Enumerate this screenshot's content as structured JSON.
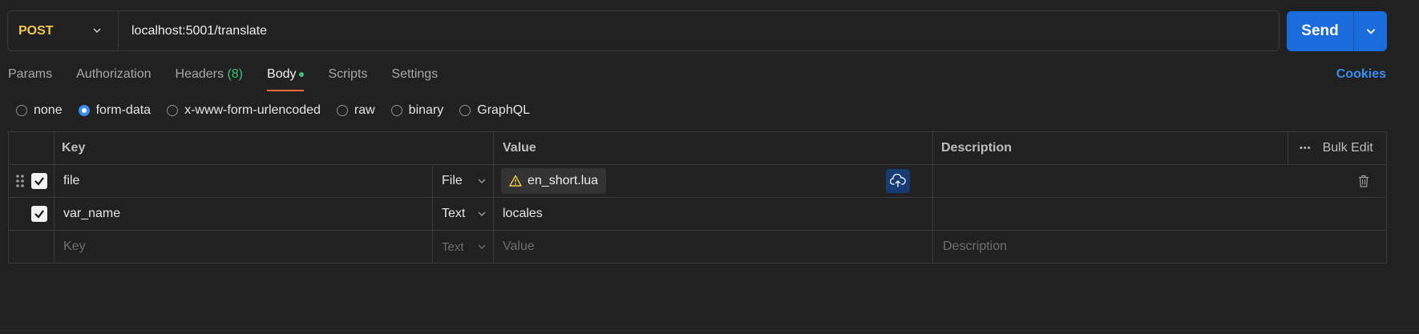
{
  "request": {
    "method": "POST",
    "url": "localhost:5001/translate",
    "send_label": "Send"
  },
  "tabs": [
    {
      "label": "Params"
    },
    {
      "label": "Authorization"
    },
    {
      "label": "Headers",
      "count": "(8)"
    },
    {
      "label": "Body",
      "active": true
    },
    {
      "label": "Scripts"
    },
    {
      "label": "Settings"
    }
  ],
  "cookies_label": "Cookies",
  "body_types": [
    {
      "label": "none",
      "selected": false
    },
    {
      "label": "form-data",
      "selected": true
    },
    {
      "label": "x-www-form-urlencoded",
      "selected": false
    },
    {
      "label": "raw",
      "selected": false
    },
    {
      "label": "binary",
      "selected": false
    },
    {
      "label": "GraphQL",
      "selected": false
    }
  ],
  "table": {
    "headers": {
      "key": "Key",
      "value": "Value",
      "description": "Description",
      "bulk_edit": "Bulk Edit"
    },
    "rows": [
      {
        "key": "file",
        "type": "File",
        "value": "en_short.lua",
        "checked": true
      },
      {
        "key": "var_name",
        "type": "Text",
        "value": "locales",
        "checked": true
      }
    ],
    "placeholder": {
      "key": "Key",
      "type": "Text",
      "value": "Value",
      "description": "Description"
    }
  },
  "colors": {
    "accent": "#1a6bdc",
    "method": "#f2c94c",
    "tab_underline": "#f06a3b",
    "count": "#3fbf74",
    "link": "#3a8ef6"
  }
}
